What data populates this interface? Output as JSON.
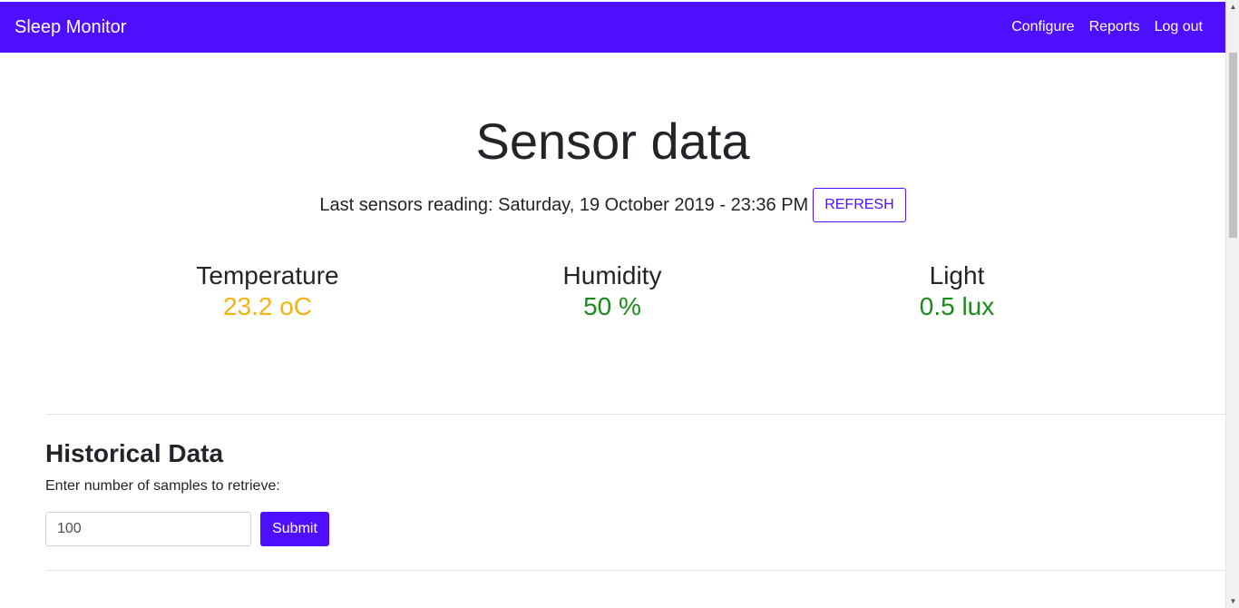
{
  "navbar": {
    "brand": "Sleep Monitor",
    "links": [
      "Configure",
      "Reports",
      "Log out"
    ],
    "background": "#4f0fff"
  },
  "header": {
    "title": "Sensor data",
    "reading_label": "Last sensors reading: Saturday, 19 October 2019 - 23:36 PM",
    "refresh_label": "REFRESH"
  },
  "sensors": [
    {
      "label": "Temperature",
      "value": "23.2 oC",
      "color": "#f6b310"
    },
    {
      "label": "Humidity",
      "value": "50 %",
      "color": "#1a8a1a"
    },
    {
      "label": "Light",
      "value": "0.5 lux",
      "color": "#1a8a1a"
    }
  ],
  "historical": {
    "title": "Historical Data",
    "prompt": "Enter number of samples to retrieve:",
    "input_value": "100",
    "submit_label": "Submit"
  }
}
